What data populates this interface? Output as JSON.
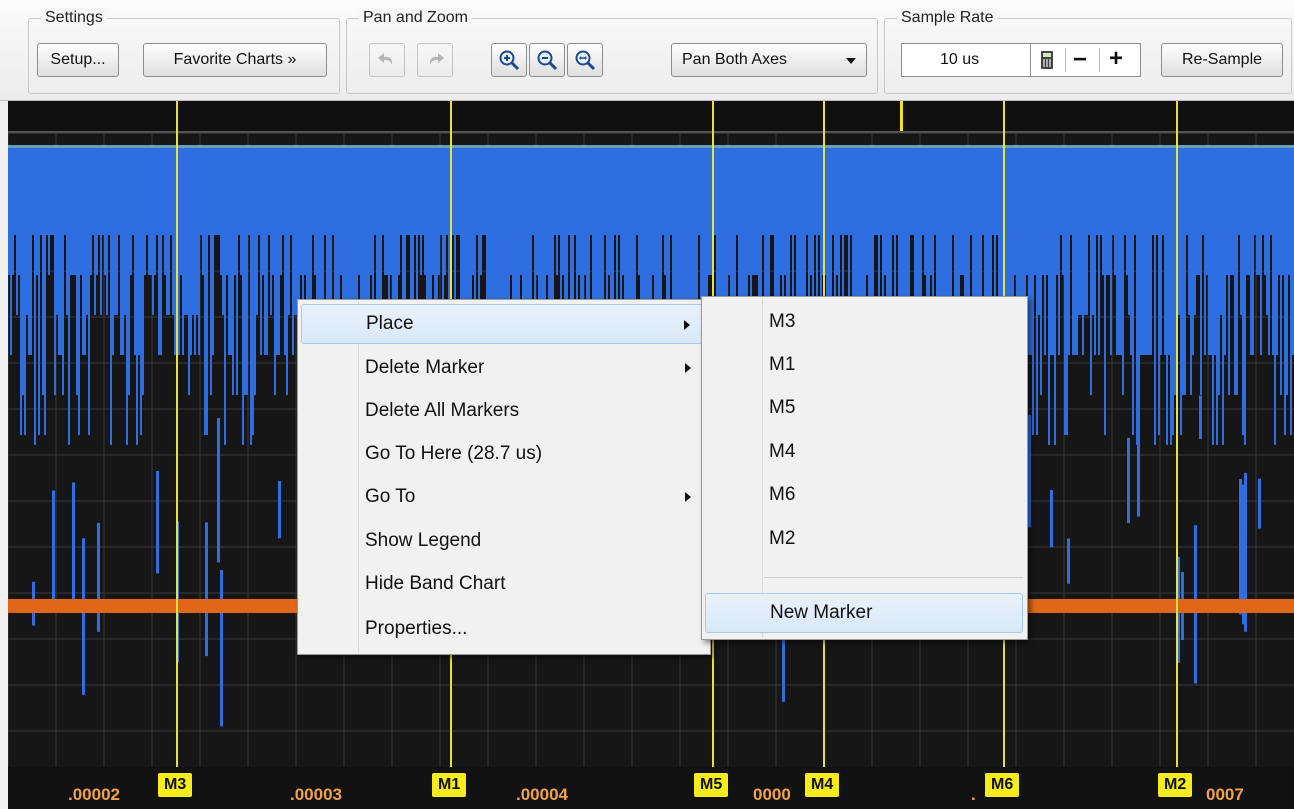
{
  "toolbar": {
    "settings": {
      "title": "Settings",
      "setup_label": "Setup...",
      "favorites_label": "Favorite Charts »"
    },
    "pan_zoom": {
      "title": "Pan and Zoom",
      "undo_icon": "undo-icon",
      "redo_icon": "redo-icon",
      "zoom_in_icon": "zoom-in-icon",
      "zoom_out_icon": "zoom-out-icon",
      "zoom_fit_icon": "zoom-fit-icon",
      "pan_mode_label": "Pan Both Axes"
    },
    "sample_rate": {
      "title": "Sample Rate",
      "value": "10 us",
      "calculator_icon": "calculator-icon",
      "minus_label": "−",
      "plus_label": "+",
      "resample_label": "Re-Sample"
    }
  },
  "chart": {
    "colors": {
      "background": "#161616",
      "signal": "#2e6ee0",
      "baseline": "#e0661a",
      "marker": "#e8e33a",
      "tick_text": "#f2a24b"
    },
    "x_ticks": [
      ".00002",
      ".00003",
      ".00004",
      "0000",
      ".",
      "0007"
    ],
    "markers": [
      "M3",
      "M1",
      "M5",
      "M4",
      "M6",
      "M2"
    ]
  },
  "context_menu": {
    "items": [
      {
        "label": "Place",
        "submenu": true
      },
      {
        "label": "Delete Marker",
        "submenu": true
      },
      {
        "label": "Delete All Markers",
        "submenu": false
      },
      {
        "label": "Go To Here (28.7 us)",
        "submenu": false
      },
      {
        "label": "Go To",
        "submenu": true
      },
      {
        "label": "Show Legend",
        "submenu": false
      },
      {
        "label": "Hide Band Chart",
        "submenu": false
      },
      {
        "label": "Properties...",
        "submenu": false
      }
    ],
    "highlighted": "Place"
  },
  "submenu": {
    "items": [
      "M3",
      "M1",
      "M5",
      "M4",
      "M6",
      "M2"
    ],
    "new_marker_label": "New Marker"
  }
}
